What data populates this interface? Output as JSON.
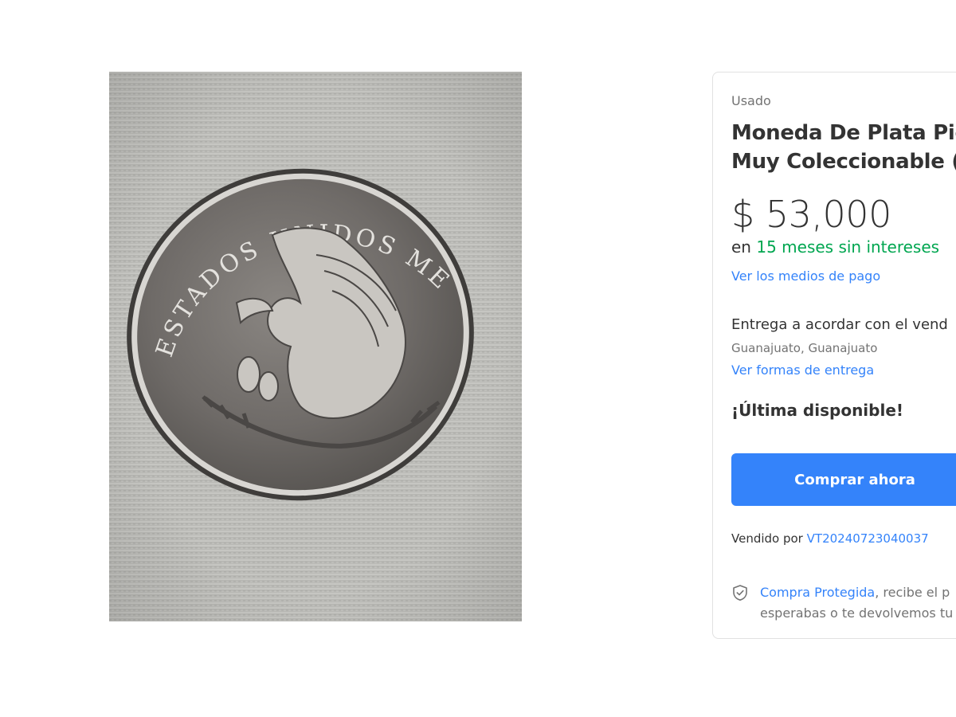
{
  "gallery": {
    "image_alt": "Moneda de plata con escudo y leyenda ESTADOS UNIDOS MEXICANOS",
    "coin_legend": "ESTADOS UNIDOS MEXICANOS"
  },
  "product": {
    "condition": "Usado",
    "title_line1": "Moneda De Plata Pie",
    "title_line2": "Muy Coleccionable (U",
    "price": "$ 53,000",
    "installments_prefix": "en",
    "installments_highlight": "15 meses sin intereses",
    "payment_link": "Ver los medios de pago"
  },
  "shipping": {
    "delivery_text": "Entrega a acordar con el vend",
    "location": "Guanajuato, Guanajuato",
    "delivery_link": "Ver formas de entrega"
  },
  "stock": {
    "label": "¡Última disponible!"
  },
  "actions": {
    "buy_now": "Comprar ahora"
  },
  "seller": {
    "prefix": "Vendido por",
    "name": "VT20240723040037"
  },
  "protection": {
    "link": "Compra Protegida",
    "text_line1_rest": ", recibe el p",
    "text_line2": "esperabas o te devolvemos tu"
  },
  "colors": {
    "link": "#3483fa",
    "accent_green": "#00a650",
    "button": "#3483fa",
    "text": "#333333",
    "muted": "#737373",
    "border": "#e1e1e1"
  }
}
